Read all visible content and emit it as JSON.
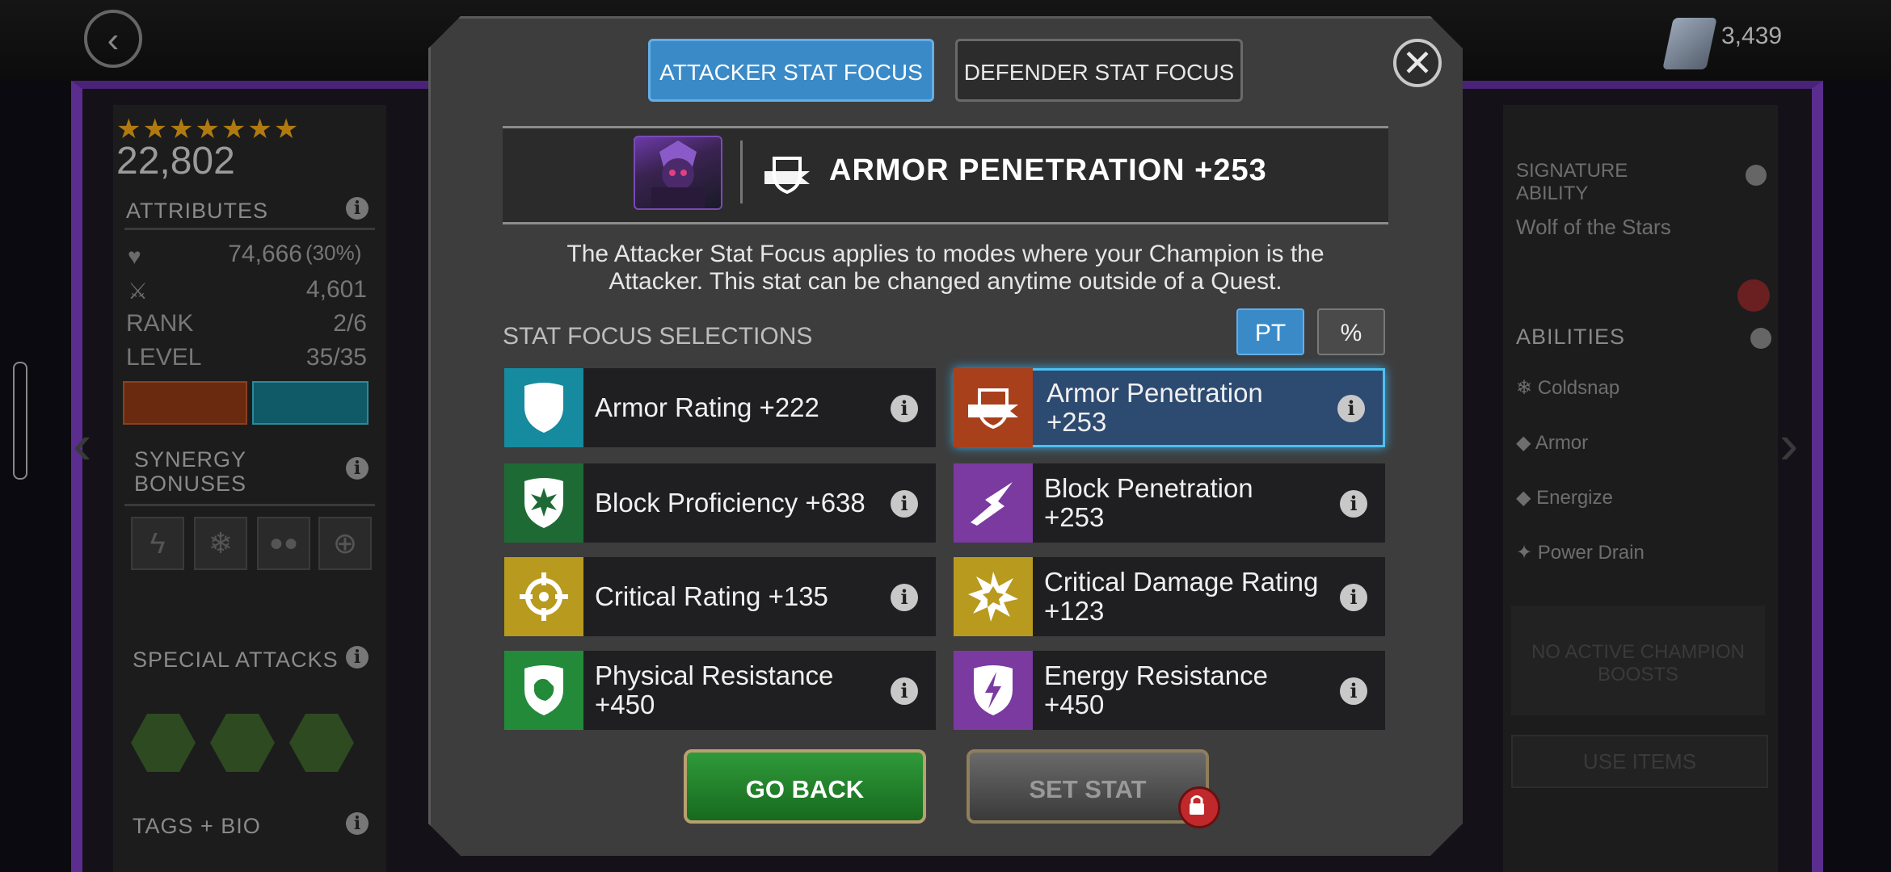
{
  "background": {
    "currency_count": "3,439",
    "left_panel": {
      "stars": "★★★★★★★",
      "rating": "22,802",
      "attributes_heading": "ATTRIBUTES",
      "health_value": "74,666",
      "health_percent": "(30%)",
      "attack_value": "4,601",
      "rank_label": "RANK",
      "rank_value": "2/6",
      "level_label": "LEVEL",
      "level_value": "35/35",
      "synergy_heading": "SYNERGY BONUSES",
      "special_attacks_heading": "SPECIAL ATTACKS",
      "tags_heading": "TAGS + BIO"
    },
    "right_panel": {
      "signature_label": "SIGNATURE ABILITY",
      "signature_value": "Wolf of the Stars",
      "abilities_heading": "ABILITIES",
      "abilities": [
        "Coldsnap",
        "Armor",
        "Energize",
        "Power Drain"
      ],
      "boosts_text": "NO ACTIVE CHAMPION BOOSTS",
      "use_items": "USE ITEMS"
    }
  },
  "modal": {
    "tab_attacker": "ATTACKER STAT FOCUS",
    "tab_defender": "DEFENDER STAT FOCUS",
    "close": "✕",
    "summary_text": "ARMOR PENETRATION +253",
    "description_line1": "The Attacker Stat Focus applies to modes where your Champion is the",
    "description_line2": "Attacker. This stat can be changed anytime outside of a Quest.",
    "selections_label": "STAT FOCUS SELECTIONS",
    "toggle_pt": "PT",
    "toggle_pct": "%",
    "stats": [
      {
        "label": "Armor Rating +222",
        "color": "#168a9e",
        "icon": "shield-icon",
        "selected": false
      },
      {
        "label": "Armor Penetration +253",
        "color": "#a8401c",
        "icon": "armor-penetration-icon",
        "selected": true
      },
      {
        "label": "Block Proficiency +638",
        "color": "#1e6a34",
        "icon": "block-proficiency-icon",
        "selected": false
      },
      {
        "label": "Block Penetration +253",
        "color": "#7a3aa0",
        "icon": "block-penetration-icon",
        "selected": false
      },
      {
        "label": "Critical Rating +135",
        "color": "#b89a1e",
        "icon": "crosshair-icon",
        "selected": false
      },
      {
        "label": "Critical Damage Rating +123",
        "color": "#b89a1e",
        "icon": "burst-icon",
        "selected": false
      },
      {
        "label": "Physical Resistance +450",
        "color": "#238a3a",
        "icon": "physical-resistance-icon",
        "selected": false
      },
      {
        "label": "Energy Resistance +450",
        "color": "#7a3aa0",
        "icon": "energy-resistance-icon",
        "selected": false
      }
    ],
    "go_back": "GO BACK",
    "set_stat": "SET STAT"
  }
}
